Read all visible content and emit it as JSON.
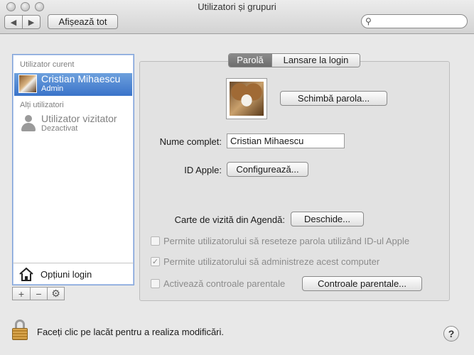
{
  "window": {
    "title": "Utilizatori și grupuri"
  },
  "toolbar": {
    "back_icon": "chevron-left",
    "forward_icon": "chevron-right",
    "show_all_label": "Afișează tot",
    "search_placeholder": "",
    "search_icon": "magnifier"
  },
  "sidebar": {
    "current_user_header": "Utilizator curent",
    "current_user": {
      "name": "Cristian Mihaescu",
      "role": "Admin",
      "selected": true
    },
    "other_users_header": "Alți utilizatori",
    "other_users": [
      {
        "name": "Utilizator vizitator",
        "status": "Dezactivat"
      }
    ],
    "login_options_label": "Opțiuni login",
    "buttons": [
      "+",
      "−",
      "⚙"
    ]
  },
  "tabs": [
    {
      "label": "Parolă",
      "active": true
    },
    {
      "label": "Lansare la login",
      "active": false
    }
  ],
  "account": {
    "change_password_label": "Schimbă parola...",
    "full_name_label": "Nume complet:",
    "full_name_value": "Cristian Mihaescu",
    "apple_id_label": "ID Apple:",
    "apple_id_button": "Configurează...",
    "contact_card_label": "Carte de vizită din Agendă:",
    "contact_card_button": "Deschide...",
    "options": [
      {
        "label": "Permite utilizatorului să reseteze parola utilizând ID-ul Apple",
        "checked": false
      },
      {
        "label": "Permite utilizatorului să administreze acest computer",
        "checked": true
      },
      {
        "label": "Activează controale parentale",
        "checked": false
      }
    ],
    "parental_controls_button": "Controale parentale..."
  },
  "footer": {
    "lock_text": "Faceți clic pe lacăt pentru a realiza modificări.",
    "help_label": "?"
  }
}
